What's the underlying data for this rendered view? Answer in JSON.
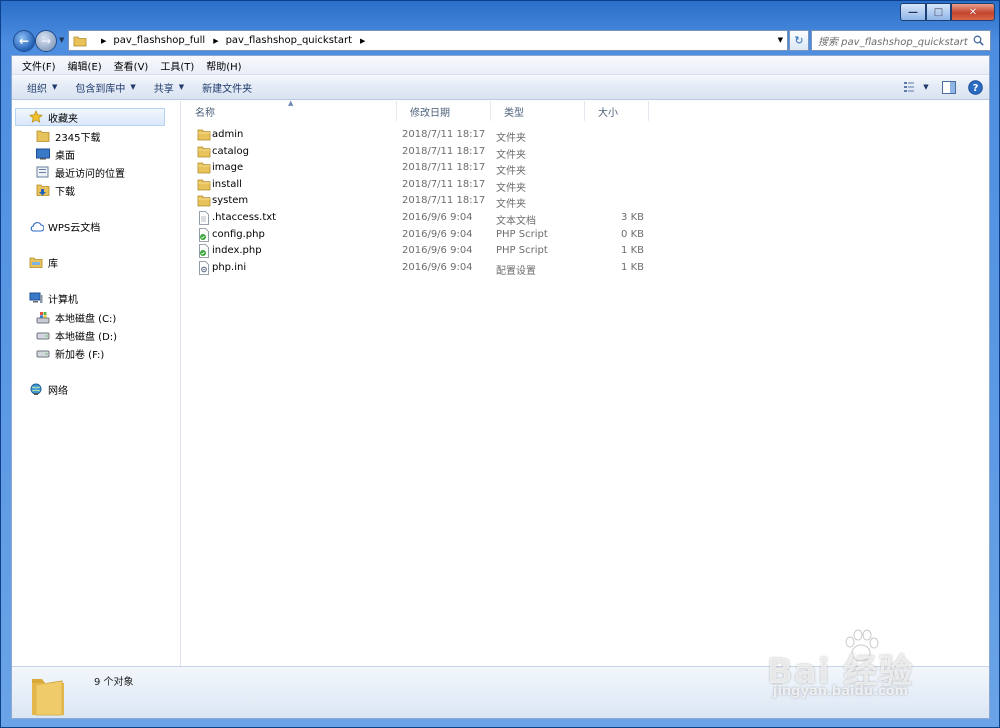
{
  "window": {
    "minimize_glyph": "—",
    "maximize_glyph": "□",
    "close_glyph": "✕"
  },
  "address": {
    "crumbs": [
      "pav_flashshop_full",
      "pav_flashshop_quickstart"
    ],
    "search_placeholder": "搜索 pav_flashshop_quickstart"
  },
  "menubar": [
    "文件(F)",
    "编辑(E)",
    "查看(V)",
    "工具(T)",
    "帮助(H)"
  ],
  "toolbar": {
    "organize": "组织",
    "include_in_library": "包含到库中",
    "share": "共享",
    "new_folder": "新建文件夹"
  },
  "navpane": {
    "favorites": "收藏夹",
    "favorites_items": [
      "2345下载",
      "桌面",
      "最近访问的位置",
      "下载"
    ],
    "wps": "WPS云文档",
    "library": "库",
    "computer": "计算机",
    "computer_items": [
      "本地磁盘 (C:)",
      "本地磁盘 (D:)",
      "新加卷 (F:)"
    ],
    "network": "网络"
  },
  "columns": {
    "name": "名称",
    "date": "修改日期",
    "type": "类型",
    "size": "大小"
  },
  "files": [
    {
      "name": "admin",
      "date": "2018/7/11 18:17",
      "type": "文件夹",
      "size": "",
      "icon": "folder-icon"
    },
    {
      "name": "catalog",
      "date": "2018/7/11 18:17",
      "type": "文件夹",
      "size": "",
      "icon": "folder-icon"
    },
    {
      "name": "image",
      "date": "2018/7/11 18:17",
      "type": "文件夹",
      "size": "",
      "icon": "folder-icon"
    },
    {
      "name": "install",
      "date": "2018/7/11 18:17",
      "type": "文件夹",
      "size": "",
      "icon": "folder-icon"
    },
    {
      "name": "system",
      "date": "2018/7/11 18:17",
      "type": "文件夹",
      "size": "",
      "icon": "folder-icon"
    },
    {
      "name": ".htaccess.txt",
      "date": "2016/9/6 9:04",
      "type": "文本文档",
      "size": "3 KB",
      "icon": "text-file-icon"
    },
    {
      "name": "config.php",
      "date": "2016/9/6 9:04",
      "type": "PHP Script",
      "size": "0 KB",
      "icon": "php-file-icon"
    },
    {
      "name": "index.php",
      "date": "2016/9/6 9:04",
      "type": "PHP Script",
      "size": "1 KB",
      "icon": "php-file-icon"
    },
    {
      "name": "php.ini",
      "date": "2016/9/6 9:04",
      "type": "配置设置",
      "size": "1 KB",
      "icon": "settings-file-icon"
    }
  ],
  "details": {
    "count": "9 个对象"
  },
  "watermark": {
    "brand": "Bai 经验",
    "url": "jingyan.baidu.com"
  },
  "colors": {
    "folder": "#e8c25a",
    "accent": "#2461b8"
  }
}
